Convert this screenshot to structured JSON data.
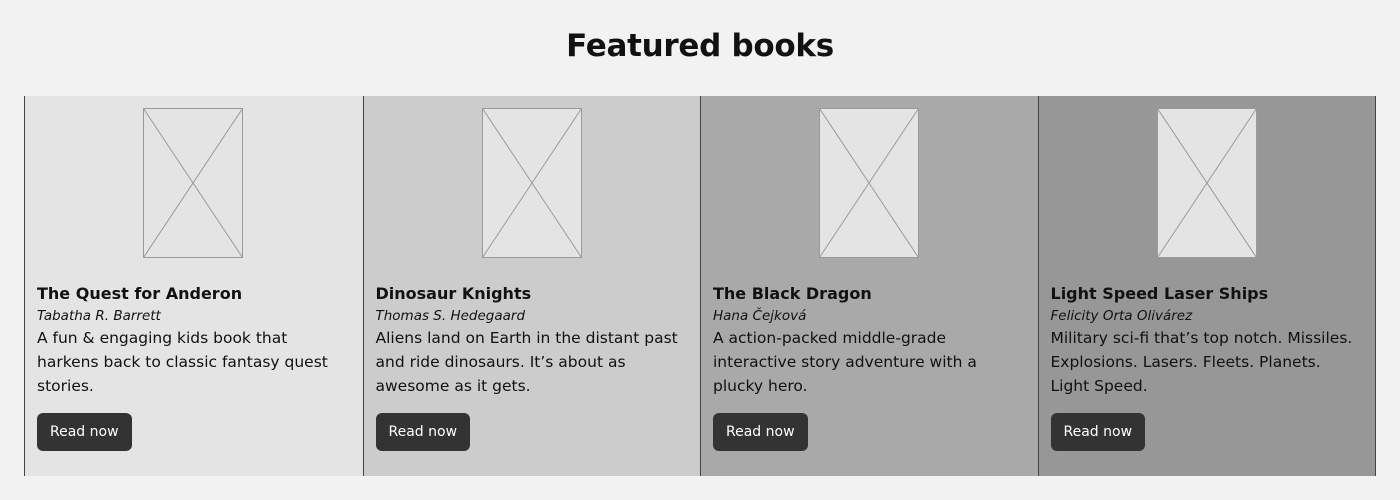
{
  "page": {
    "title": "Featured books"
  },
  "books": [
    {
      "title": "The Quest for Anderon",
      "author": "Tabatha R. Barrett",
      "description": "A fun & engaging kids book that harkens back to classic fantasy quest stories.",
      "button_label": "Read now",
      "background": "#e4e4e4"
    },
    {
      "title": "Dinosaur Knights",
      "author": "Thomas S. Hedegaard",
      "description": "Aliens land on Earth in the distant past and ride dinosaurs. It’s about as awesome as it gets.",
      "button_label": "Read now",
      "background": "#cccccc"
    },
    {
      "title": "The Black Dragon",
      "author": "Hana Čejková",
      "description": "A action-packed middle-grade interactive story adventure with a plucky hero.",
      "button_label": "Read now",
      "background": "#a9a9a9"
    },
    {
      "title": "Light Speed Laser Ships",
      "author": "Felicity Orta Olivárez",
      "description": "Military sci-fi that’s top notch. Missiles. Explosions. Lasers. Fleets. Planets. Light Speed.",
      "button_label": "Read now",
      "background": "#979797"
    }
  ],
  "colors": {
    "page_background": "#f2f2f2",
    "button_background": "#333333",
    "button_text": "#ffffff",
    "placeholder_fill": "#e4e4e4",
    "placeholder_stroke": "#9a9a9a"
  }
}
